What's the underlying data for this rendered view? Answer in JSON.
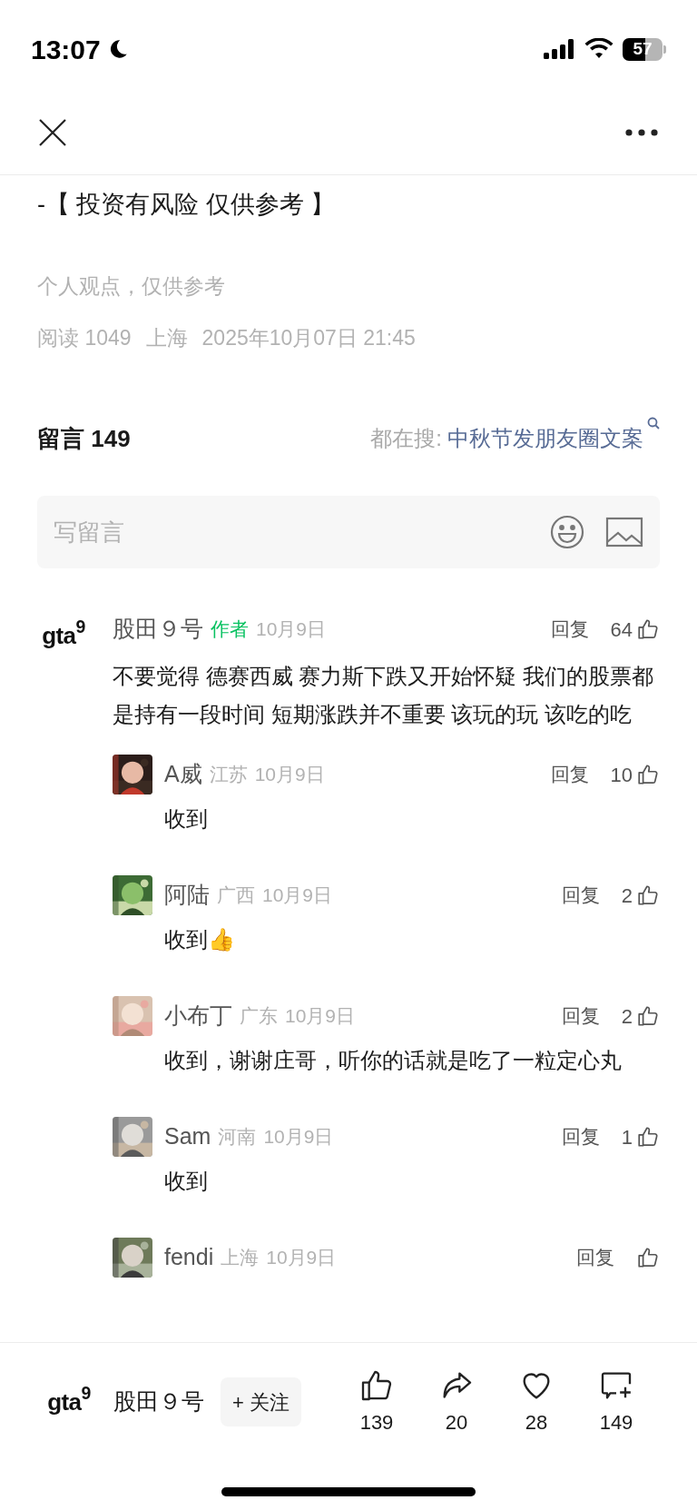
{
  "status_bar": {
    "time": "13:07",
    "battery": "57"
  },
  "article": {
    "tail_line": "-【 投资有风险 仅供参考 】",
    "note": "个人观点，仅供参考",
    "meta": [
      "阅读 1049",
      "上海",
      "2025年10月07日 21:45"
    ]
  },
  "comments_header": {
    "title": "留言 149",
    "search_prefix": "都在搜:",
    "search_term": "中秋节发朋友圈文案"
  },
  "compose": {
    "placeholder": "写留言"
  },
  "comments": [
    {
      "avatar_logo": "gta$^{9}$",
      "name": "股田９号",
      "badge": "作者",
      "date": "10月9日",
      "reply": "回复",
      "likes": "64",
      "text": "不要觉得 德赛西威 赛力斯下跌又开始怀疑 我们的股票都是持有一段时间 短期涨跌并不重要 该玩的玩 该吃的吃",
      "replies": [
        {
          "name": "A威",
          "location": "江苏",
          "date": "10月9日",
          "reply": "回复",
          "likes": "10",
          "text": "收到"
        },
        {
          "name": "阿陆",
          "location": "广西",
          "date": "10月9日",
          "reply": "回复",
          "likes": "2",
          "text": "收到👍"
        },
        {
          "name": "小布丁",
          "location": "广东",
          "date": "10月9日",
          "reply": "回复",
          "likes": "2",
          "text": "收到，谢谢庄哥，听你的话就是吃了一粒定心丸"
        },
        {
          "name": "Sam",
          "location": "河南",
          "date": "10月9日",
          "reply": "回复",
          "likes": "1",
          "text": "收到"
        },
        {
          "name": "fendi",
          "location": "上海",
          "date": "10月9日",
          "reply": "回复"
        }
      ]
    }
  ],
  "bottom_bar": {
    "logo": "gta$^{9}$",
    "name": "股田９号",
    "follow": "+ 关注",
    "actions": [
      {
        "kind": "like",
        "count": "139"
      },
      {
        "kind": "share",
        "count": "20"
      },
      {
        "kind": "favorite",
        "count": "28"
      },
      {
        "kind": "comment",
        "count": "149"
      }
    ]
  }
}
